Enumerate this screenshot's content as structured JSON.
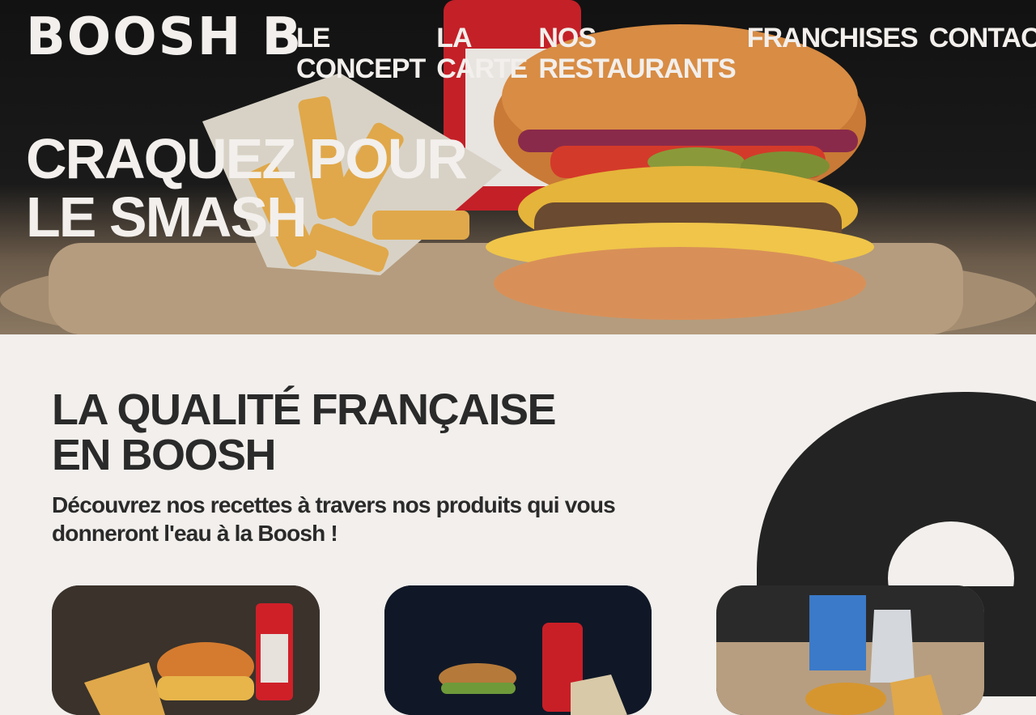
{
  "brand": {
    "logo_text": "BOOSH B"
  },
  "nav": {
    "items": [
      {
        "label": "LE CONCEPT"
      },
      {
        "label": "LA CARTE"
      },
      {
        "label": "NOS RESTAURANTS"
      },
      {
        "label": "FRANCHISES"
      },
      {
        "label": "CONTACT"
      }
    ]
  },
  "hero": {
    "title_line1": "CRAQUEZ POUR",
    "title_line2": "LE SMASH"
  },
  "section": {
    "title_line1": "LA QUALITÉ FRANÇAISE",
    "title_line2": "EN BOOSH",
    "subtitle": "Découvrez nos recettes à travers nos produits qui vous donneront l'eau à la Boosh !"
  },
  "cards": [
    {
      "label": "burger-menu-photo-1"
    },
    {
      "label": "burger-menu-photo-2"
    },
    {
      "label": "kids-menu-photo"
    }
  ],
  "colors": {
    "dark": "#232323",
    "light": "#f2efec",
    "accent": "#d9262b"
  }
}
